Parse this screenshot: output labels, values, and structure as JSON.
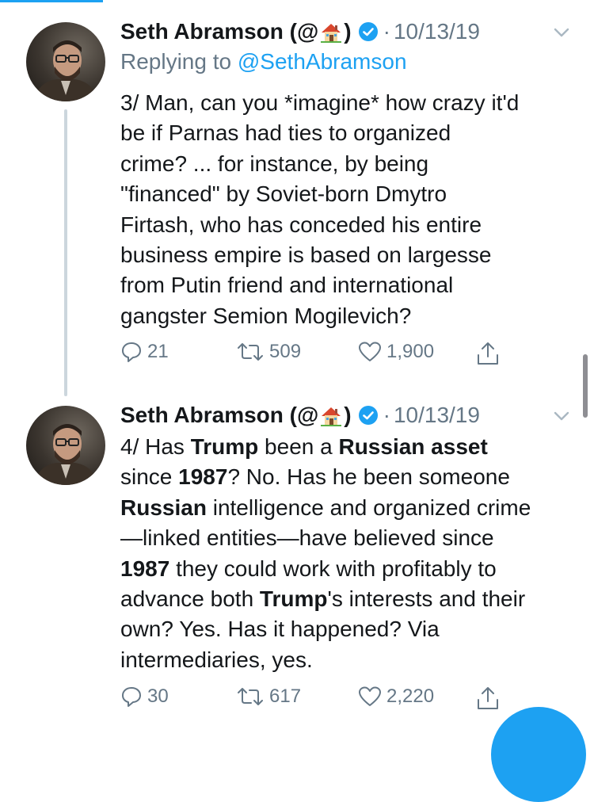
{
  "colors": {
    "accent": "#1da1f2",
    "text": "#14171a",
    "secondary": "#657786",
    "thread_line": "#ccd6dd"
  },
  "tweets": [
    {
      "author": {
        "name_prefix": "Seth Abramson (@",
        "name_suffix": ")",
        "emoji": "house-emoji",
        "verified": true
      },
      "separator": "·",
      "date": "10/13/19",
      "reply_prefix": "Replying to ",
      "reply_handle": "@SethAbramson",
      "text_lines": [
        "3/ Man, can you *imagine* how crazy it'd",
        "be if Parnas had ties to organized",
        "crime? ... for instance, by being",
        "\"financed\" by Soviet-born Dmytro",
        "Firtash, who has conceded his entire",
        "business empire is based on largesse",
        "from Putin friend and international",
        "gangster Semion Mogilevich?"
      ],
      "replies": "21",
      "retweets": "509",
      "likes": "1,900"
    },
    {
      "author": {
        "name_prefix": "Seth Abramson (@",
        "name_suffix": ")",
        "emoji": "house-emoji",
        "verified": true
      },
      "separator": "·",
      "date": "10/13/19",
      "text_segments": {
        "l1": [
          "4/ Has ",
          "Trump",
          " been a ",
          "Russian asset"
        ],
        "l2": [
          "since ",
          "1987",
          "? No. Has he been someone"
        ],
        "l3": [
          "Russian",
          " intelligence and organized crime"
        ],
        "l4": "—linked entities—have believed since",
        "l5": [
          "1987",
          " they could work with profitably to"
        ],
        "l6": [
          "advance both ",
          "Trump",
          "'s interests and their"
        ],
        "l7": "own? Yes. Has it happened? Via",
        "l8": "intermediaries, yes."
      },
      "replies": "30",
      "retweets": "617",
      "likes": "2,220"
    }
  ]
}
